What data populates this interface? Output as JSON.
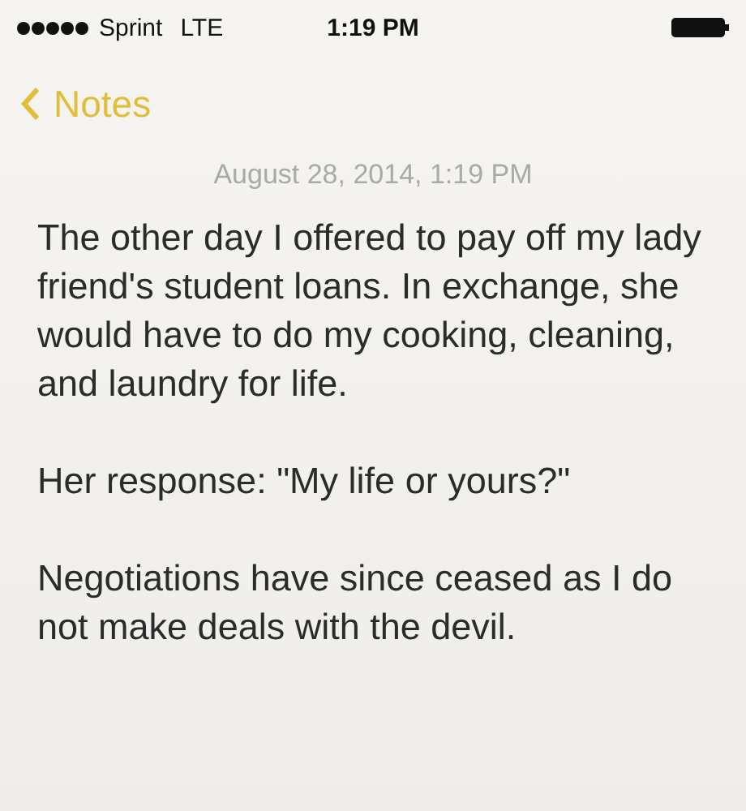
{
  "status_bar": {
    "carrier": "Sprint",
    "network": "LTE",
    "time": "1:19 PM"
  },
  "nav": {
    "back_label": "Notes"
  },
  "note": {
    "date": "August 28, 2014, 1:19 PM",
    "paragraphs": [
      "The other day I offered to pay off my lady friend's student loans. In exchange, she would have to do my cooking, cleaning, and laundry for life.",
      "Her response: \"My life or yours?\"",
      "Negotiations have since ceased as I do not make deals with the devil."
    ]
  }
}
